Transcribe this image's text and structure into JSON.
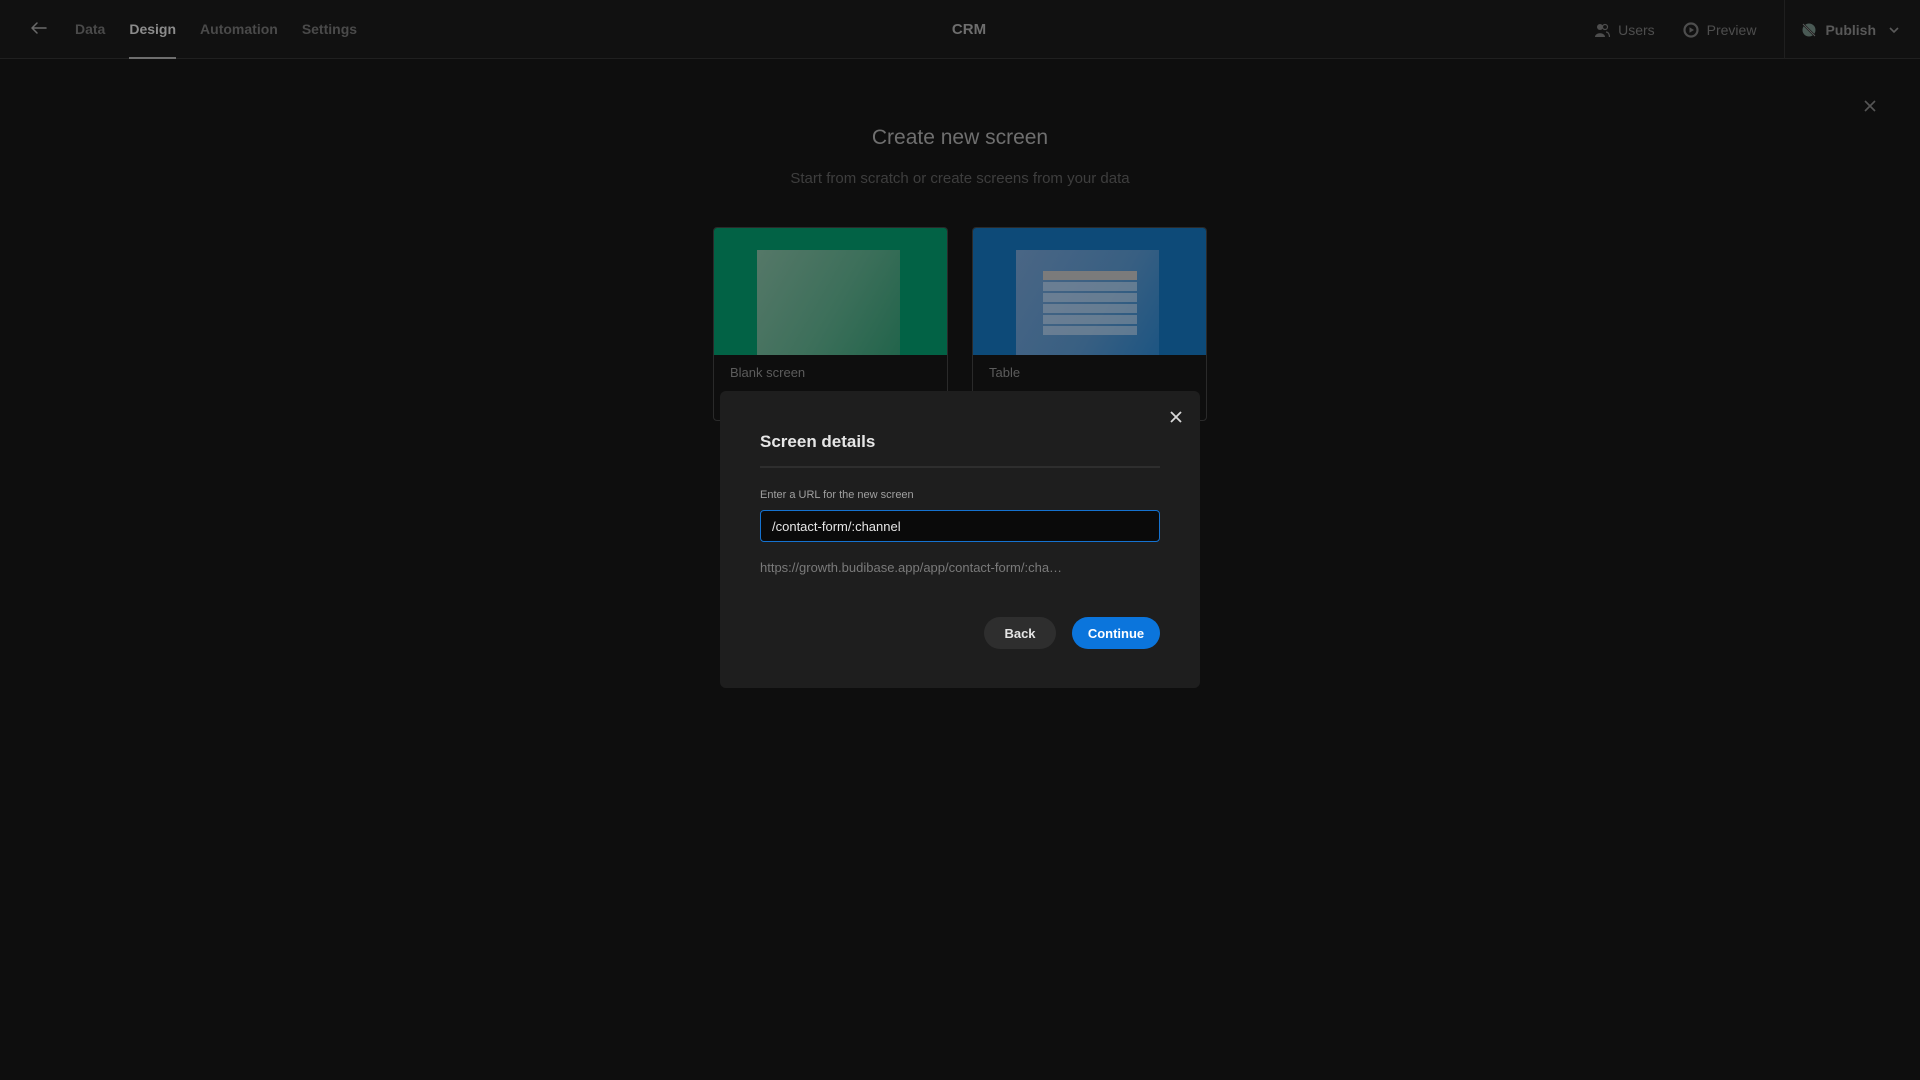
{
  "topbar": {
    "nav_tabs": [
      {
        "label": "Data",
        "active": false
      },
      {
        "label": "Design",
        "active": true
      },
      {
        "label": "Automation",
        "active": false
      },
      {
        "label": "Settings",
        "active": false
      }
    ],
    "app_title": "CRM",
    "actions": {
      "users_label": "Users",
      "preview_label": "Preview",
      "publish_label": "Publish"
    }
  },
  "page": {
    "title": "Create new screen",
    "subtitle": "Start from scratch or create screens from your data",
    "templates": [
      {
        "label": "Blank screen",
        "color": "#026245"
      },
      {
        "label": "Table",
        "color": "#0d4a78"
      }
    ]
  },
  "modal": {
    "title": "Screen details",
    "field_label": "Enter a URL for the new screen",
    "url_value": "/contact-form/:channel",
    "url_preview": "https://growth.budibase.app/app/contact-form/:cha…",
    "back_label": "Back",
    "continue_label": "Continue",
    "accent_color": "#0b75dc"
  }
}
